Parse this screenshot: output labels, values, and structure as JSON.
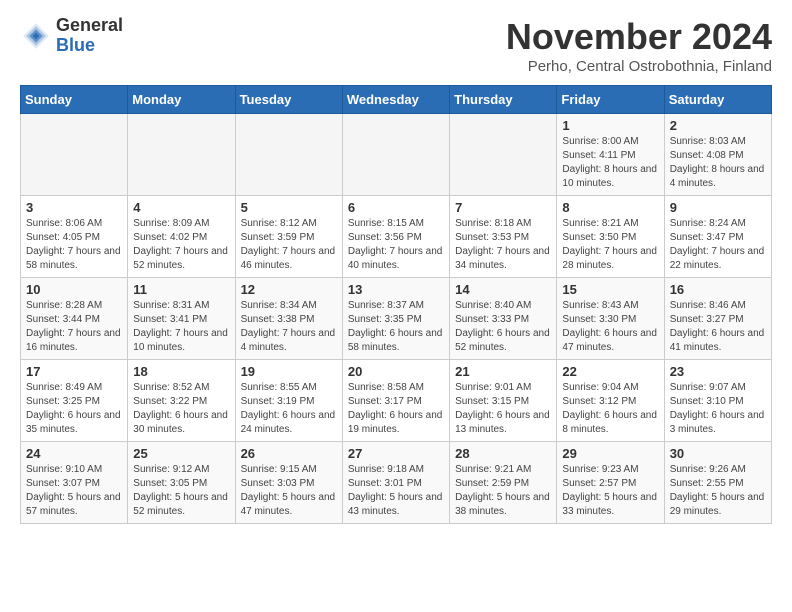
{
  "logo": {
    "general": "General",
    "blue": "Blue"
  },
  "title": "November 2024",
  "location": "Perho, Central Ostrobothnia, Finland",
  "days_header": [
    "Sunday",
    "Monday",
    "Tuesday",
    "Wednesday",
    "Thursday",
    "Friday",
    "Saturday"
  ],
  "weeks": [
    [
      {
        "day": "",
        "info": ""
      },
      {
        "day": "",
        "info": ""
      },
      {
        "day": "",
        "info": ""
      },
      {
        "day": "",
        "info": ""
      },
      {
        "day": "",
        "info": ""
      },
      {
        "day": "1",
        "info": "Sunrise: 8:00 AM\nSunset: 4:11 PM\nDaylight: 8 hours and 10 minutes."
      },
      {
        "day": "2",
        "info": "Sunrise: 8:03 AM\nSunset: 4:08 PM\nDaylight: 8 hours and 4 minutes."
      }
    ],
    [
      {
        "day": "3",
        "info": "Sunrise: 8:06 AM\nSunset: 4:05 PM\nDaylight: 7 hours and 58 minutes."
      },
      {
        "day": "4",
        "info": "Sunrise: 8:09 AM\nSunset: 4:02 PM\nDaylight: 7 hours and 52 minutes."
      },
      {
        "day": "5",
        "info": "Sunrise: 8:12 AM\nSunset: 3:59 PM\nDaylight: 7 hours and 46 minutes."
      },
      {
        "day": "6",
        "info": "Sunrise: 8:15 AM\nSunset: 3:56 PM\nDaylight: 7 hours and 40 minutes."
      },
      {
        "day": "7",
        "info": "Sunrise: 8:18 AM\nSunset: 3:53 PM\nDaylight: 7 hours and 34 minutes."
      },
      {
        "day": "8",
        "info": "Sunrise: 8:21 AM\nSunset: 3:50 PM\nDaylight: 7 hours and 28 minutes."
      },
      {
        "day": "9",
        "info": "Sunrise: 8:24 AM\nSunset: 3:47 PM\nDaylight: 7 hours and 22 minutes."
      }
    ],
    [
      {
        "day": "10",
        "info": "Sunrise: 8:28 AM\nSunset: 3:44 PM\nDaylight: 7 hours and 16 minutes."
      },
      {
        "day": "11",
        "info": "Sunrise: 8:31 AM\nSunset: 3:41 PM\nDaylight: 7 hours and 10 minutes."
      },
      {
        "day": "12",
        "info": "Sunrise: 8:34 AM\nSunset: 3:38 PM\nDaylight: 7 hours and 4 minutes."
      },
      {
        "day": "13",
        "info": "Sunrise: 8:37 AM\nSunset: 3:35 PM\nDaylight: 6 hours and 58 minutes."
      },
      {
        "day": "14",
        "info": "Sunrise: 8:40 AM\nSunset: 3:33 PM\nDaylight: 6 hours and 52 minutes."
      },
      {
        "day": "15",
        "info": "Sunrise: 8:43 AM\nSunset: 3:30 PM\nDaylight: 6 hours and 47 minutes."
      },
      {
        "day": "16",
        "info": "Sunrise: 8:46 AM\nSunset: 3:27 PM\nDaylight: 6 hours and 41 minutes."
      }
    ],
    [
      {
        "day": "17",
        "info": "Sunrise: 8:49 AM\nSunset: 3:25 PM\nDaylight: 6 hours and 35 minutes."
      },
      {
        "day": "18",
        "info": "Sunrise: 8:52 AM\nSunset: 3:22 PM\nDaylight: 6 hours and 30 minutes."
      },
      {
        "day": "19",
        "info": "Sunrise: 8:55 AM\nSunset: 3:19 PM\nDaylight: 6 hours and 24 minutes."
      },
      {
        "day": "20",
        "info": "Sunrise: 8:58 AM\nSunset: 3:17 PM\nDaylight: 6 hours and 19 minutes."
      },
      {
        "day": "21",
        "info": "Sunrise: 9:01 AM\nSunset: 3:15 PM\nDaylight: 6 hours and 13 minutes."
      },
      {
        "day": "22",
        "info": "Sunrise: 9:04 AM\nSunset: 3:12 PM\nDaylight: 6 hours and 8 minutes."
      },
      {
        "day": "23",
        "info": "Sunrise: 9:07 AM\nSunset: 3:10 PM\nDaylight: 6 hours and 3 minutes."
      }
    ],
    [
      {
        "day": "24",
        "info": "Sunrise: 9:10 AM\nSunset: 3:07 PM\nDaylight: 5 hours and 57 minutes."
      },
      {
        "day": "25",
        "info": "Sunrise: 9:12 AM\nSunset: 3:05 PM\nDaylight: 5 hours and 52 minutes."
      },
      {
        "day": "26",
        "info": "Sunrise: 9:15 AM\nSunset: 3:03 PM\nDaylight: 5 hours and 47 minutes."
      },
      {
        "day": "27",
        "info": "Sunrise: 9:18 AM\nSunset: 3:01 PM\nDaylight: 5 hours and 43 minutes."
      },
      {
        "day": "28",
        "info": "Sunrise: 9:21 AM\nSunset: 2:59 PM\nDaylight: 5 hours and 38 minutes."
      },
      {
        "day": "29",
        "info": "Sunrise: 9:23 AM\nSunset: 2:57 PM\nDaylight: 5 hours and 33 minutes."
      },
      {
        "day": "30",
        "info": "Sunrise: 9:26 AM\nSunset: 2:55 PM\nDaylight: 5 hours and 29 minutes."
      }
    ]
  ]
}
